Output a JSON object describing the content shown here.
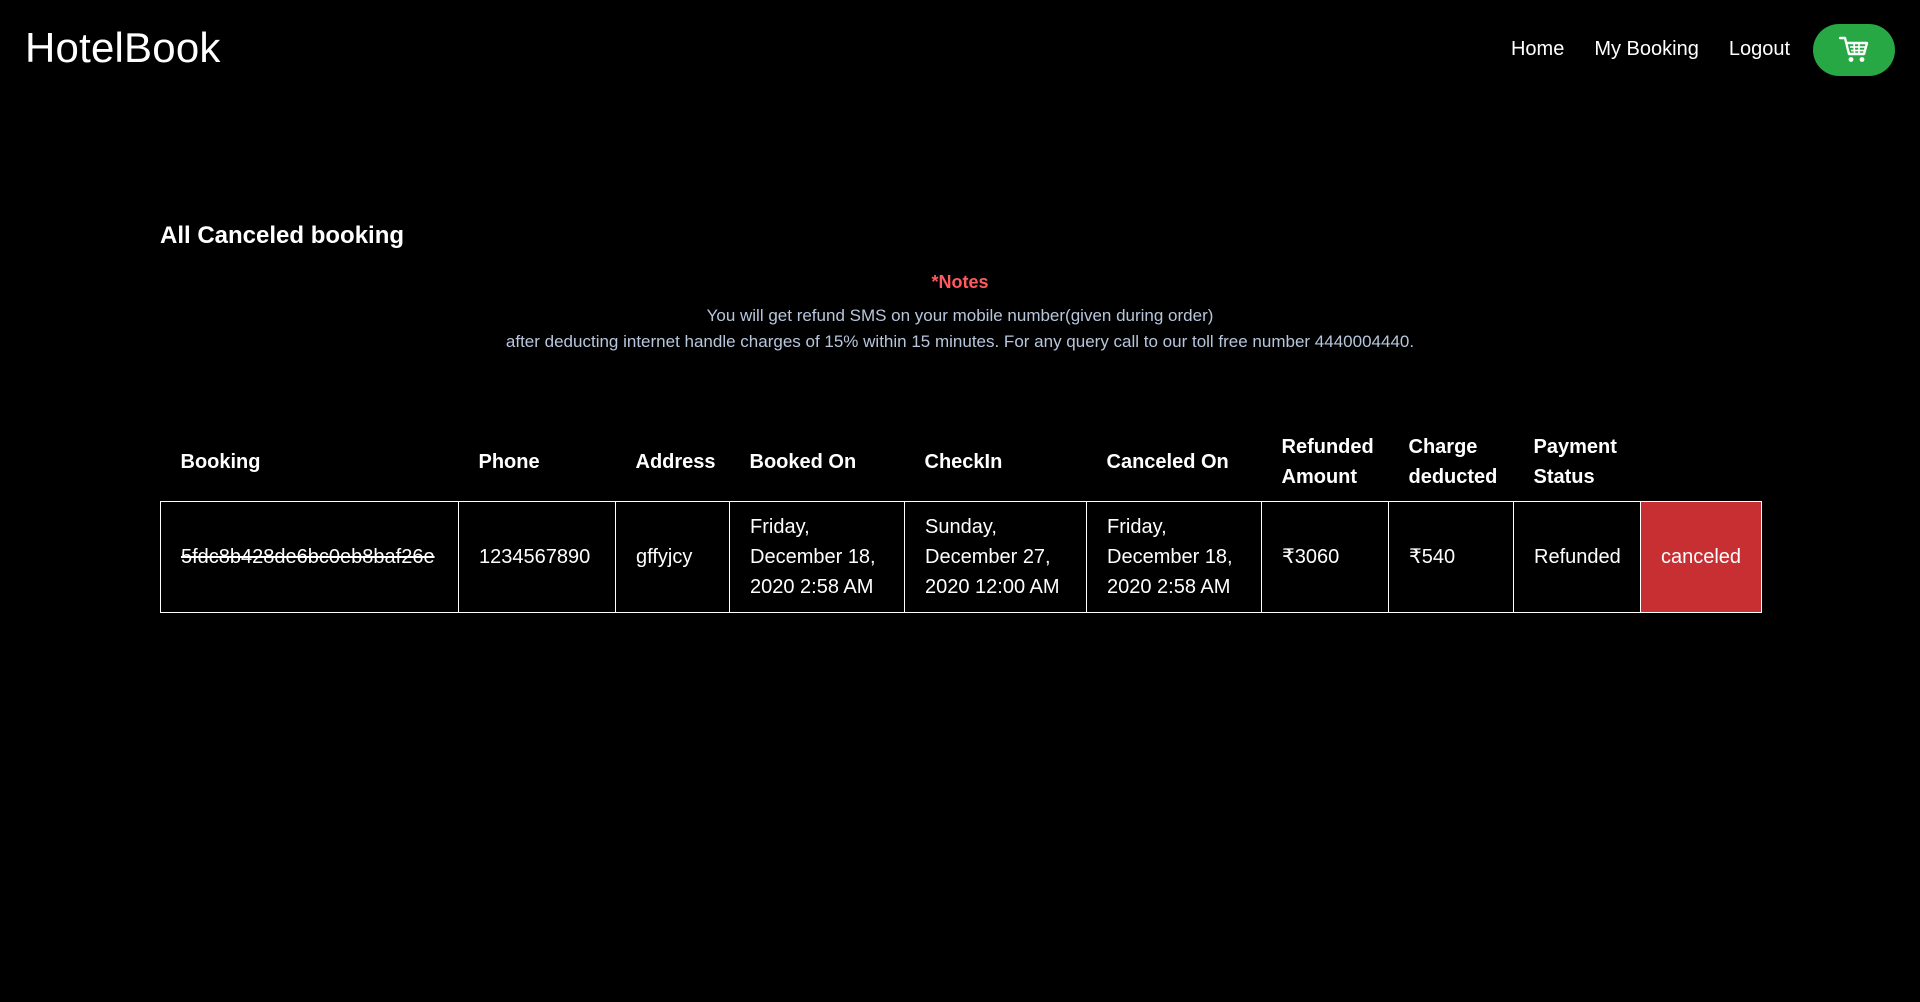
{
  "nav": {
    "brand": "HotelBook",
    "links": [
      "Home",
      "My Booking",
      "Logout"
    ],
    "cart_icon": "shopping-cart-icon",
    "cart_color": "#28a745"
  },
  "page": {
    "title": "All Canceled booking"
  },
  "notes": {
    "heading": "*Notes",
    "line1": "You will get refund SMS on your mobile number(given during order)",
    "line2": "after deducting internet handle charges of 15% within 15 minutes. For any query call to our toll free number 4440004440."
  },
  "table": {
    "headers": [
      "Booking",
      "Phone",
      "Address",
      "Booked On",
      "CheckIn",
      "Canceled On",
      "Refunded Amount",
      "Charge deducted",
      "Payment Status",
      ""
    ],
    "rows": [
      {
        "booking": "5fdc8b428de6bc0eb8baf26e",
        "phone": "1234567890",
        "address": "gffyjcy",
        "booked_on": "Friday, December 18, 2020 2:58 AM",
        "checkin": "Sunday, December 27, 2020 12:00 AM",
        "canceled_on": "Friday, December 18, 2020 2:58 AM",
        "refunded_amount": "₹3060",
        "charge_deducted": "₹540",
        "payment_status": "Refunded",
        "status": "canceled"
      }
    ]
  },
  "colors": {
    "background": "#000000",
    "notes_heading": "#ff5a5f",
    "notes_text": "#b8c6dc",
    "canceled_badge": "#c82f33"
  }
}
